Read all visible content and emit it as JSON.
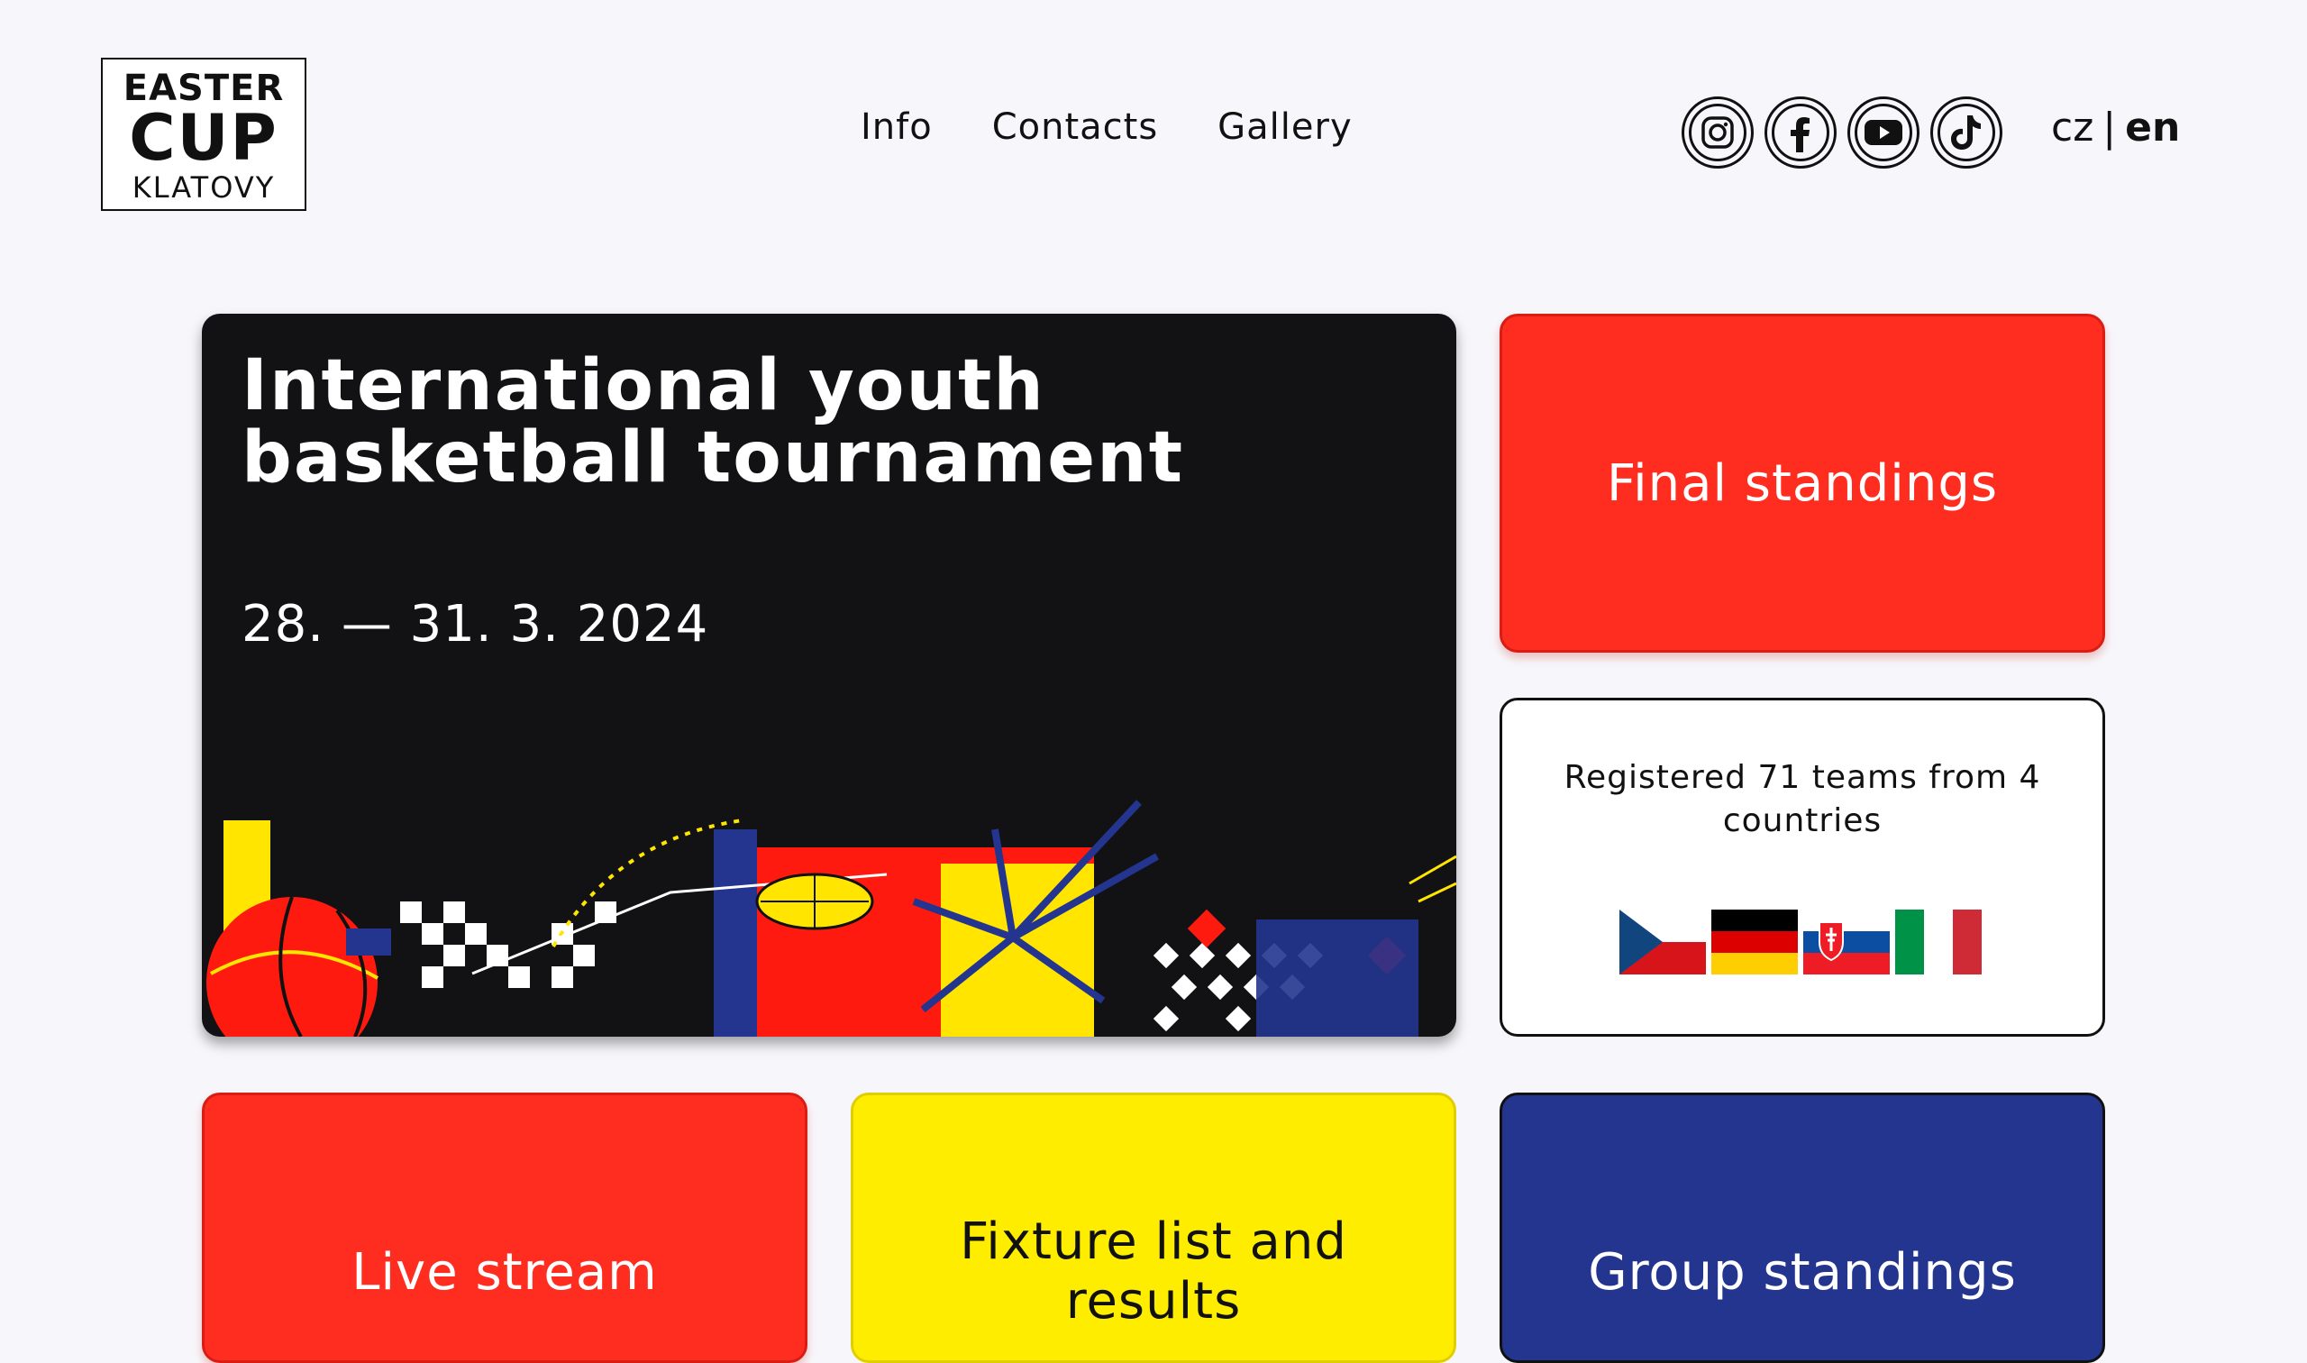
{
  "logo": {
    "line1": "EASTER",
    "line2": "CUP",
    "line3": "KLATOVY"
  },
  "nav": {
    "items": [
      "Info",
      "Contacts",
      "Gallery"
    ]
  },
  "social": {
    "icons": [
      "instagram-icon",
      "facebook-icon",
      "youtube-icon",
      "tiktok-icon"
    ]
  },
  "language": {
    "cz": "cz",
    "separator": "|",
    "en": "en",
    "active": "en"
  },
  "hero": {
    "title": "International youth basketball tournament",
    "date": "28. — 31. 3. 2024"
  },
  "cards": {
    "final_standings": "Final standings",
    "registered": "Registered 71 teams from 4 countries",
    "live_stream": "Live stream",
    "fixture": "Fixture list and results",
    "group_standings": "Group standings"
  },
  "flags": [
    "czech-flag",
    "german-flag",
    "slovak-flag",
    "italian-flag"
  ],
  "colors": {
    "red": "#ff2d20",
    "yellow": "#ffed00",
    "blue": "#24358f",
    "dark": "#121214",
    "background": "#f7f7fb"
  }
}
